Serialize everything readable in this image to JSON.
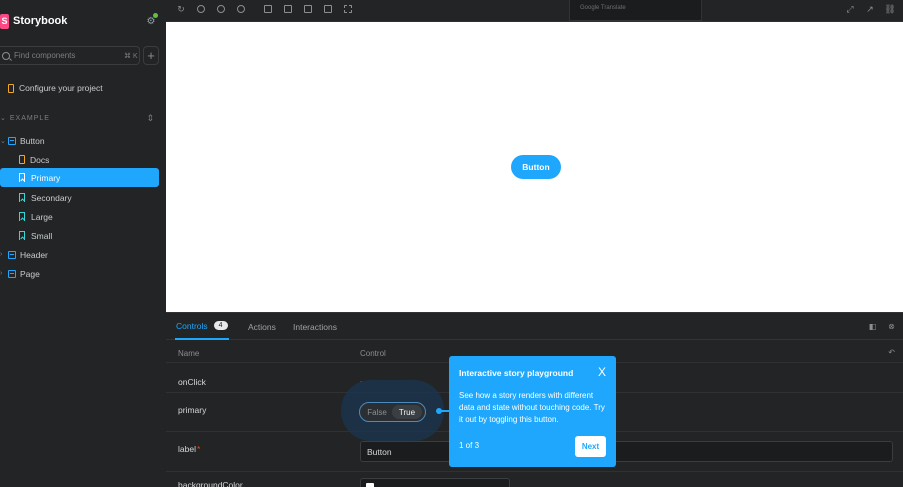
{
  "brand": {
    "name": "Storybook",
    "logo_letter": "S"
  },
  "sidebar": {
    "search_placeholder": "Find components",
    "search_shortcut": "⌘ K",
    "configure_label": "Configure your project",
    "section_label": "EXAMPLE",
    "tree": [
      {
        "label": "Button",
        "type": "component"
      },
      {
        "label": "Docs",
        "type": "docs"
      },
      {
        "label": "Primary",
        "type": "story",
        "selected": true
      },
      {
        "label": "Secondary",
        "type": "story"
      },
      {
        "label": "Large",
        "type": "story"
      },
      {
        "label": "Small",
        "type": "story"
      },
      {
        "label": "Header",
        "type": "component"
      },
      {
        "label": "Page",
        "type": "component"
      }
    ]
  },
  "toolbar": {
    "translate_popup_text": "Google Translate"
  },
  "preview": {
    "button_label": "Button"
  },
  "panel": {
    "tabs": [
      {
        "label": "Controls",
        "badge": "4",
        "active": true
      },
      {
        "label": "Actions"
      },
      {
        "label": "Interactions"
      }
    ],
    "columns": {
      "name": "Name",
      "control": "Control"
    },
    "rows": [
      {
        "name": "onClick",
        "control": "-"
      },
      {
        "name": "primary",
        "control_false": "False",
        "control_true": "True"
      },
      {
        "name": "label",
        "required": "*",
        "value": "Button"
      },
      {
        "name": "backgroundColor"
      }
    ]
  },
  "tour": {
    "title": "Interactive story playground",
    "body": "See how a story renders with different data and state without touching code. Try it out by toggling this button.",
    "step": "1 of 3",
    "next_label": "Next",
    "close_glyph": "X"
  },
  "colors": {
    "accent": "#1ea7fd",
    "sidebar_bg": "#222425",
    "brand_pink": "#ff4785",
    "required": "#ff4400"
  }
}
